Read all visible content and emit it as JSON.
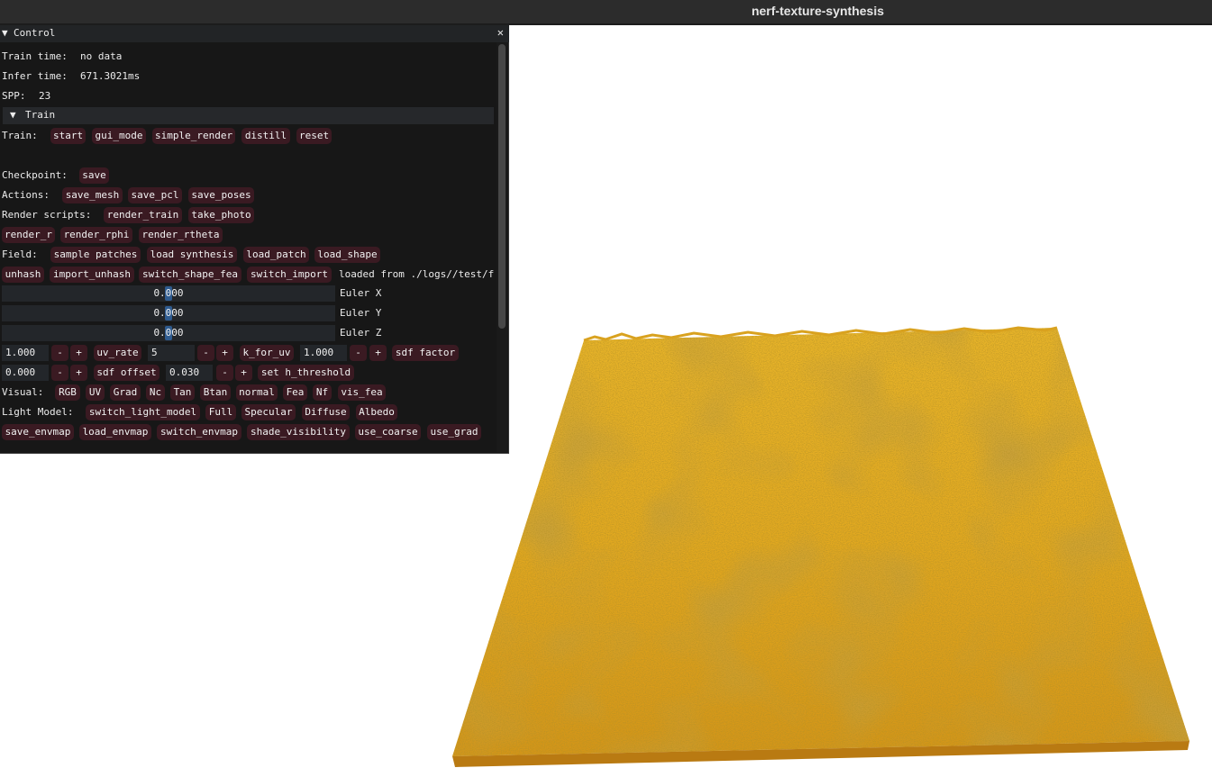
{
  "window": {
    "title": "nerf-texture-synthesis"
  },
  "control": {
    "title": "Control",
    "train_time_label": "Train time:",
    "train_time_value": "no data",
    "infer_time_label": "Infer time:",
    "infer_time_value": "671.3021ms",
    "spp_label": "SPP:",
    "spp_value": "23",
    "train_header": "Train",
    "train": {
      "label": "Train:",
      "buttons": [
        "start",
        "gui_mode",
        "simple_render",
        "distill",
        "reset"
      ]
    },
    "checkpoint": {
      "label": "Checkpoint:",
      "buttons": [
        "save"
      ]
    },
    "actions": {
      "label": "Actions:",
      "buttons": [
        "save_mesh",
        "save_pcl",
        "save_poses"
      ]
    },
    "render_scripts": {
      "label": "Render scripts:",
      "buttons": [
        "render_train",
        "take_photo"
      ]
    },
    "render_row": {
      "buttons": [
        "render_r",
        "render_rphi",
        "render_rtheta"
      ]
    },
    "field": {
      "label": "Field:",
      "buttons": [
        "sample patches",
        "load synthesis",
        "load_patch",
        "load_shape"
      ]
    },
    "import_row": {
      "buttons": [
        "unhash",
        "import_unhash",
        "switch_shape_fea",
        "switch_import"
      ],
      "status": "loaded from ./logs//test/f"
    },
    "euler": [
      {
        "value": "0.000",
        "label": "Euler X"
      },
      {
        "value": "0.000",
        "label": "Euler Y"
      },
      {
        "value": "0.000",
        "label": "Euler Z"
      }
    ],
    "params1": {
      "value1": "1.000",
      "uv_rate": "uv_rate",
      "value2": "5",
      "k_for_uv": "k_for_uv",
      "value3": "1.000",
      "sdf_factor": "sdf factor",
      "minus": "-",
      "plus": "+"
    },
    "params2": {
      "value1": "0.000",
      "sdf_offset": "sdf offset",
      "value2": "0.030",
      "set_threshold": "set h_threshold"
    },
    "visual": {
      "label": "Visual:",
      "buttons": [
        "RGB",
        "UV",
        "Grad",
        "Nc",
        "Tan",
        "Btan",
        "normal",
        "Fea",
        "Nf",
        "vis_fea"
      ]
    },
    "light_model": {
      "label": "Light Model:",
      "buttons": [
        "switch_light_model",
        "Full",
        "Specular",
        "Diffuse",
        "Albedo"
      ]
    },
    "env_row": {
      "buttons": [
        "save_envmap",
        "load_envmap",
        "switch_envmap",
        "shade_visibility",
        "use_coarse",
        "use_grad"
      ]
    },
    "icons": {
      "collapse": "triangle-down-icon",
      "close": "close-x-icon"
    }
  },
  "colors": {
    "button_bg": "#3a1a22",
    "terrain_main": "#e0a51e",
    "terrain_dark": "#8a5a10"
  }
}
